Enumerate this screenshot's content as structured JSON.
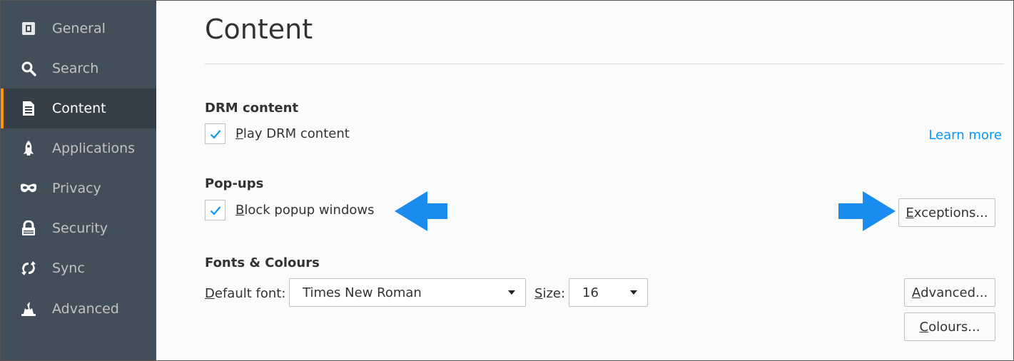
{
  "sidebar": {
    "items": [
      {
        "label": "General",
        "icon": "general-icon"
      },
      {
        "label": "Search",
        "icon": "search-icon"
      },
      {
        "label": "Content",
        "icon": "content-icon",
        "active": true
      },
      {
        "label": "Applications",
        "icon": "applications-icon"
      },
      {
        "label": "Privacy",
        "icon": "privacy-icon"
      },
      {
        "label": "Security",
        "icon": "security-icon"
      },
      {
        "label": "Sync",
        "icon": "sync-icon"
      },
      {
        "label": "Advanced",
        "icon": "advanced-icon"
      }
    ]
  },
  "main": {
    "title": "Content",
    "drm": {
      "heading": "DRM content",
      "checkbox_label_accel": "P",
      "checkbox_label_rest": "lay DRM content",
      "checked": true,
      "learn_more": "Learn more"
    },
    "popups": {
      "heading": "Pop-ups",
      "checkbox_label_accel": "B",
      "checkbox_label_rest": "lock popup windows",
      "checked": true,
      "exceptions_accel": "E",
      "exceptions_rest": "xceptions..."
    },
    "fonts": {
      "heading": "Fonts & Colours",
      "default_font_accel": "D",
      "default_font_rest": "efault font:",
      "default_font_value": "Times New Roman",
      "size_accel": "S",
      "size_rest": "ize:",
      "size_value": "16",
      "advanced_accel": "A",
      "advanced_rest": "dvanced...",
      "colours_accel": "C",
      "colours_rest": "olours..."
    }
  },
  "colors": {
    "sidebar_bg": "#424f5a",
    "sidebar_active_bg": "#343f48",
    "active_accent": "#ff9500",
    "link": "#0996f8",
    "annotation_arrow": "#1a8cf0"
  }
}
